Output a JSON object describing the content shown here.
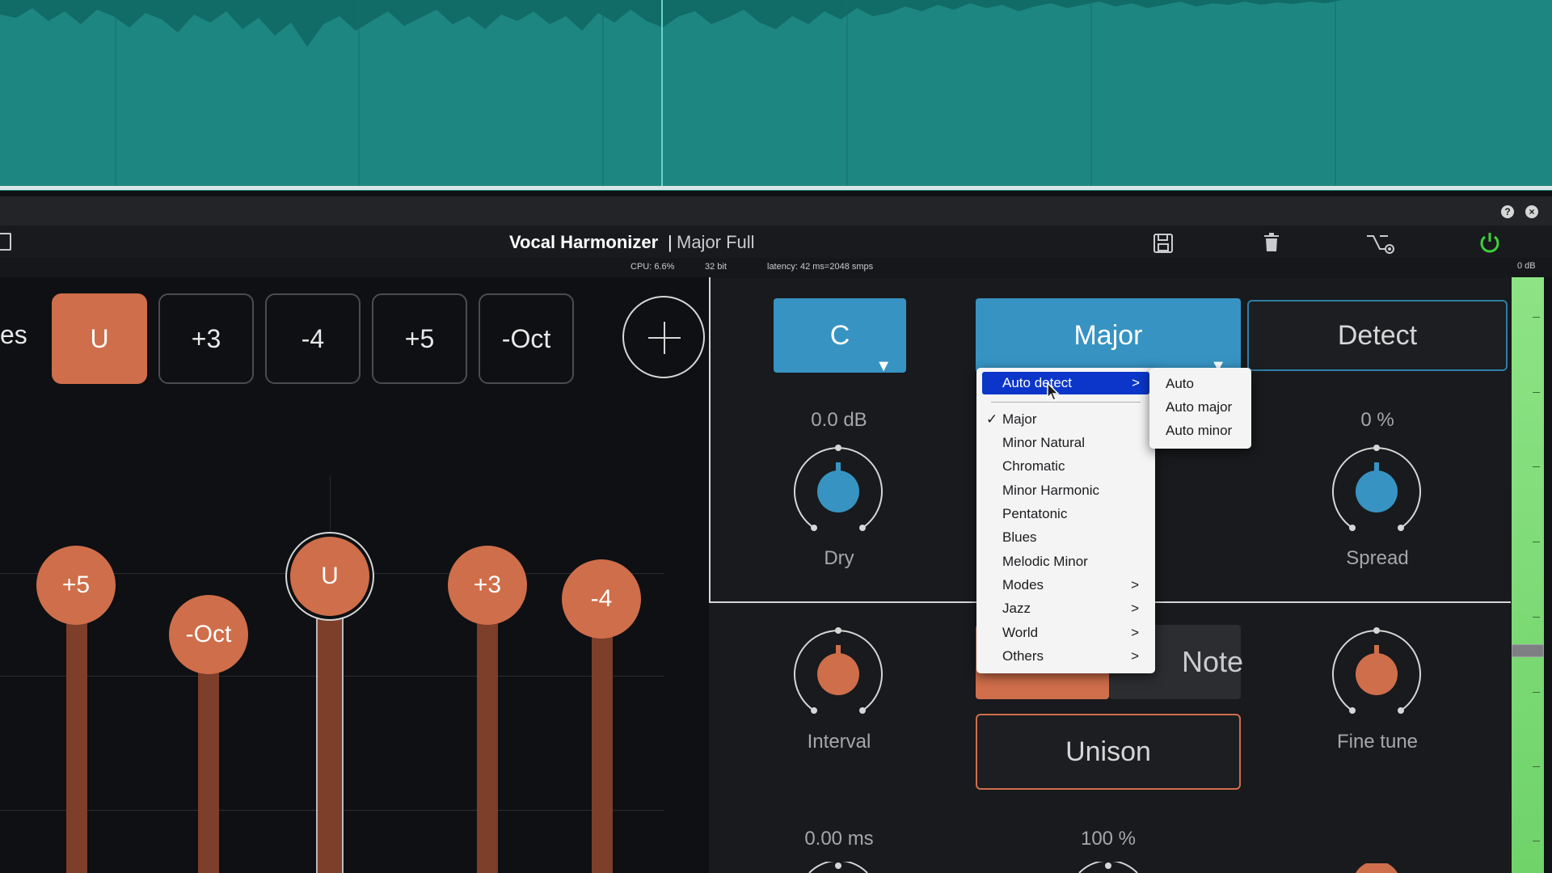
{
  "window": {
    "plugin_name": "Vocal Harmonizer",
    "separator": "|",
    "preset_name": "Major Full",
    "help_icon": "?",
    "close_icon": "×"
  },
  "status": {
    "cpu": "CPU: 6.6%",
    "bit_depth": "32 bit",
    "latency": "latency: 42 ms=2048 smps",
    "meter_db": "0 dB"
  },
  "toolbar": {
    "icons": [
      "save-icon",
      "trash-icon",
      "routing-icon",
      "power-icon"
    ],
    "power_color": "#3dd13d"
  },
  "voices": {
    "partial_label": "es",
    "chips": [
      {
        "label": "U",
        "active": true
      },
      {
        "label": "+3",
        "active": false
      },
      {
        "label": "-4",
        "active": false
      },
      {
        "label": "+5",
        "active": false
      },
      {
        "label": "-Oct",
        "active": false
      }
    ],
    "bubbles": [
      "+5",
      "-Oct",
      "U",
      "+3",
      "-4"
    ]
  },
  "key": {
    "root": "C",
    "scale": "Major",
    "detect_label": "Detect",
    "dropdown_arrow": "▼"
  },
  "params": {
    "dry_value": "0.0 dB",
    "dry_label": "Dry",
    "spread_value": "0 %",
    "spread_label": "Spread",
    "interval_label": "Interval",
    "note_label": "Note",
    "fine_tune_label": "Fine tune",
    "unison_label": "Unison",
    "delay_value": "0.00 ms",
    "mix_value": "100 %"
  },
  "scale_menu": {
    "items": [
      {
        "label": "Auto detect",
        "submenu": true,
        "highlighted": true
      },
      {
        "label": "Major",
        "checked": true
      },
      {
        "label": "Minor Natural"
      },
      {
        "label": "Chromatic"
      },
      {
        "label": "Minor Harmonic"
      },
      {
        "label": "Pentatonic"
      },
      {
        "label": "Blues"
      },
      {
        "label": "Melodic Minor"
      },
      {
        "label": "Modes",
        "submenu": true
      },
      {
        "label": "Jazz",
        "submenu": true
      },
      {
        "label": "World",
        "submenu": true
      },
      {
        "label": "Others",
        "submenu": true
      }
    ],
    "check_mark": "✓",
    "chevron": ">"
  },
  "auto_submenu": {
    "items": [
      "Auto",
      "Auto major",
      "Auto minor"
    ]
  },
  "colors": {
    "accent_blue": "#3793c2",
    "accent_orange": "#cf6e4a",
    "menu_highlight": "#0b36c9",
    "waveform": "#1e8680",
    "meter_green": "#7be075"
  }
}
